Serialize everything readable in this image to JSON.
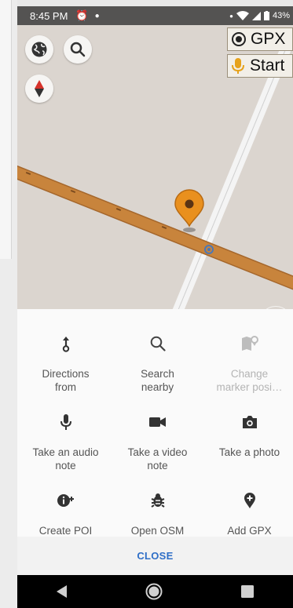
{
  "status": {
    "time": "8:45 PM",
    "battery": "43%"
  },
  "map": {
    "gpx_label": "GPX",
    "start_label": "Start",
    "route_color": "#c8843c",
    "marker_color": "#e9901e"
  },
  "sheet": {
    "options": [
      {
        "label": "Directions\nfrom",
        "icon": "directions-from-icon",
        "enabled": true
      },
      {
        "label": "Search\nnearby",
        "icon": "search-icon",
        "enabled": true
      },
      {
        "label": "Change\nmarker posi…",
        "icon": "map-marker-change-icon",
        "enabled": false
      },
      {
        "label": "Take an audio\nnote",
        "icon": "microphone-icon",
        "enabled": true
      },
      {
        "label": "Take a video\nnote",
        "icon": "video-camera-icon",
        "enabled": true
      },
      {
        "label": "Take a photo",
        "icon": "camera-icon",
        "enabled": true
      },
      {
        "label": "Create POI",
        "icon": "create-poi-icon",
        "enabled": true
      },
      {
        "label": "Open OSM",
        "icon": "bug-icon",
        "enabled": true
      },
      {
        "label": "Add GPX",
        "icon": "add-gpx-point-icon",
        "enabled": true
      }
    ],
    "close_label": "CLOSE"
  }
}
